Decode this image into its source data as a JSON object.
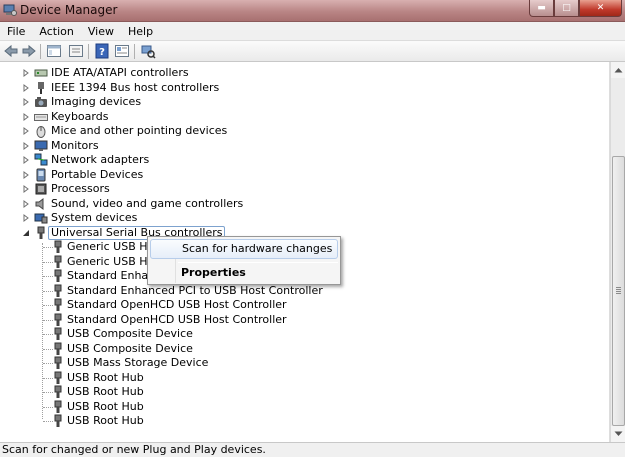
{
  "window": {
    "title": "Device Manager",
    "minimize_glyph": "▬",
    "maximize_glyph": "□",
    "close_glyph": "✕"
  },
  "menu": [
    "File",
    "Action",
    "View",
    "Help"
  ],
  "toolbar": [
    "back-icon",
    "forward-icon",
    "console-tree-icon",
    "properties-icon",
    "help-icon",
    "show-hide-icon",
    "scan-hardware-icon"
  ],
  "tree": {
    "categories": [
      {
        "label": "IDE ATA/ATAPI controllers",
        "icon": "ide-controller-icon"
      },
      {
        "label": "IEEE 1394 Bus host controllers",
        "icon": "ieee1394-icon"
      },
      {
        "label": "Imaging devices",
        "icon": "camera-icon"
      },
      {
        "label": "Keyboards",
        "icon": "keyboard-icon"
      },
      {
        "label": "Mice and other pointing devices",
        "icon": "mouse-icon"
      },
      {
        "label": "Monitors",
        "icon": "monitor-icon"
      },
      {
        "label": "Network adapters",
        "icon": "network-icon"
      },
      {
        "label": "Portable Devices",
        "icon": "portable-device-icon"
      },
      {
        "label": "Processors",
        "icon": "processor-icon"
      },
      {
        "label": "Sound, video and game controllers",
        "icon": "speaker-icon"
      },
      {
        "label": "System devices",
        "icon": "system-devices-icon"
      }
    ],
    "expanded": {
      "label": "Universal Serial Bus controllers",
      "icon": "usb-icon"
    },
    "children": [
      "Generic USB Hub",
      "Generic USB Hub",
      "Standard Enhanced PCI to USB Host Controller",
      "Standard Enhanced PCI to USB Host Controller",
      "Standard OpenHCD USB Host Controller",
      "Standard OpenHCD USB Host Controller",
      "USB Composite Device",
      "USB Composite Device",
      "USB Mass Storage Device",
      "USB Root Hub",
      "USB Root Hub",
      "USB Root Hub",
      "USB Root Hub"
    ]
  },
  "context_menu": {
    "scan": "Scan for hardware changes",
    "properties": "Properties"
  },
  "status": "Scan for changed or new Plug and Play devices.",
  "colors": {
    "title_bar": "#b98585",
    "selection_border": "#7da2ce",
    "close_button": "#c0392b"
  }
}
